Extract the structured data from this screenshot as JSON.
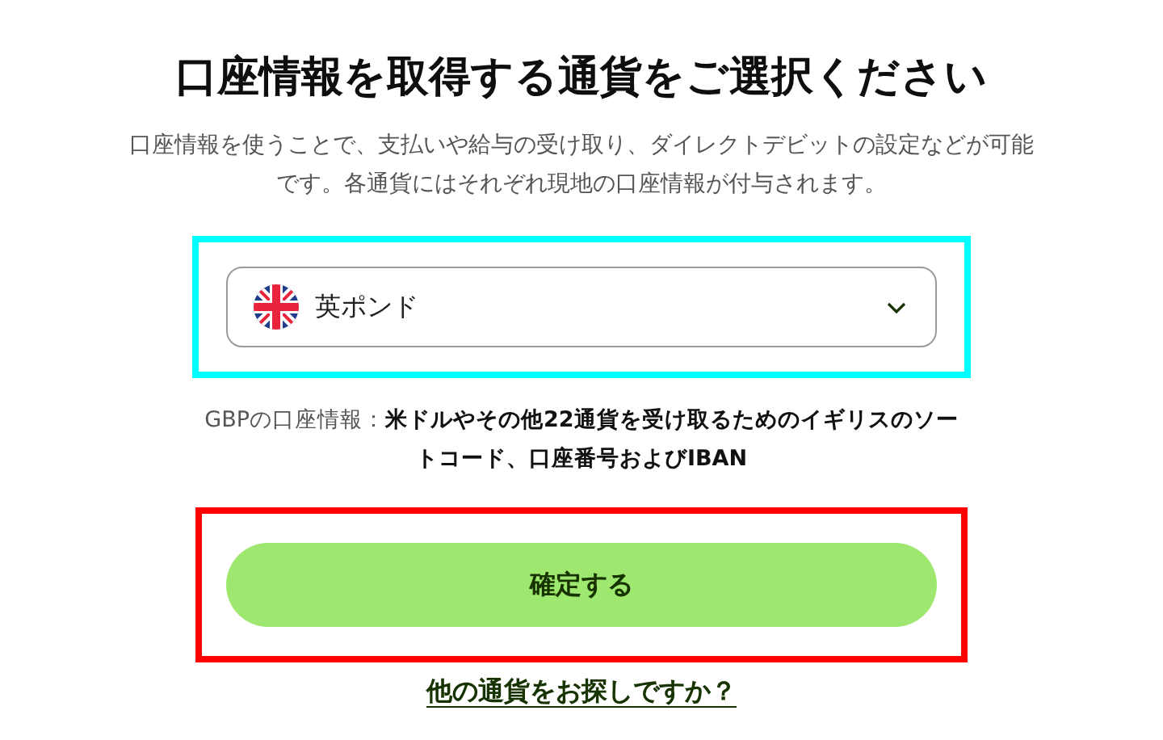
{
  "title": "口座情報を取得する通貨をご選択ください",
  "description": "口座情報を使うことで、支払いや給与の受け取り、ダイレクトデビットの設定などが可能です。各通貨にはそれぞれ現地の口座情報が付与されます。",
  "currency_select": {
    "value": "英ポンド"
  },
  "account_info": "GBPの口座情報：**米ドルやその他22通貨を受け取るためのイギリスのソートコード、口座番号およびIBAN**",
  "confirm_button": "確定する",
  "other_currency_link": "他の通貨をお探しですか？"
}
